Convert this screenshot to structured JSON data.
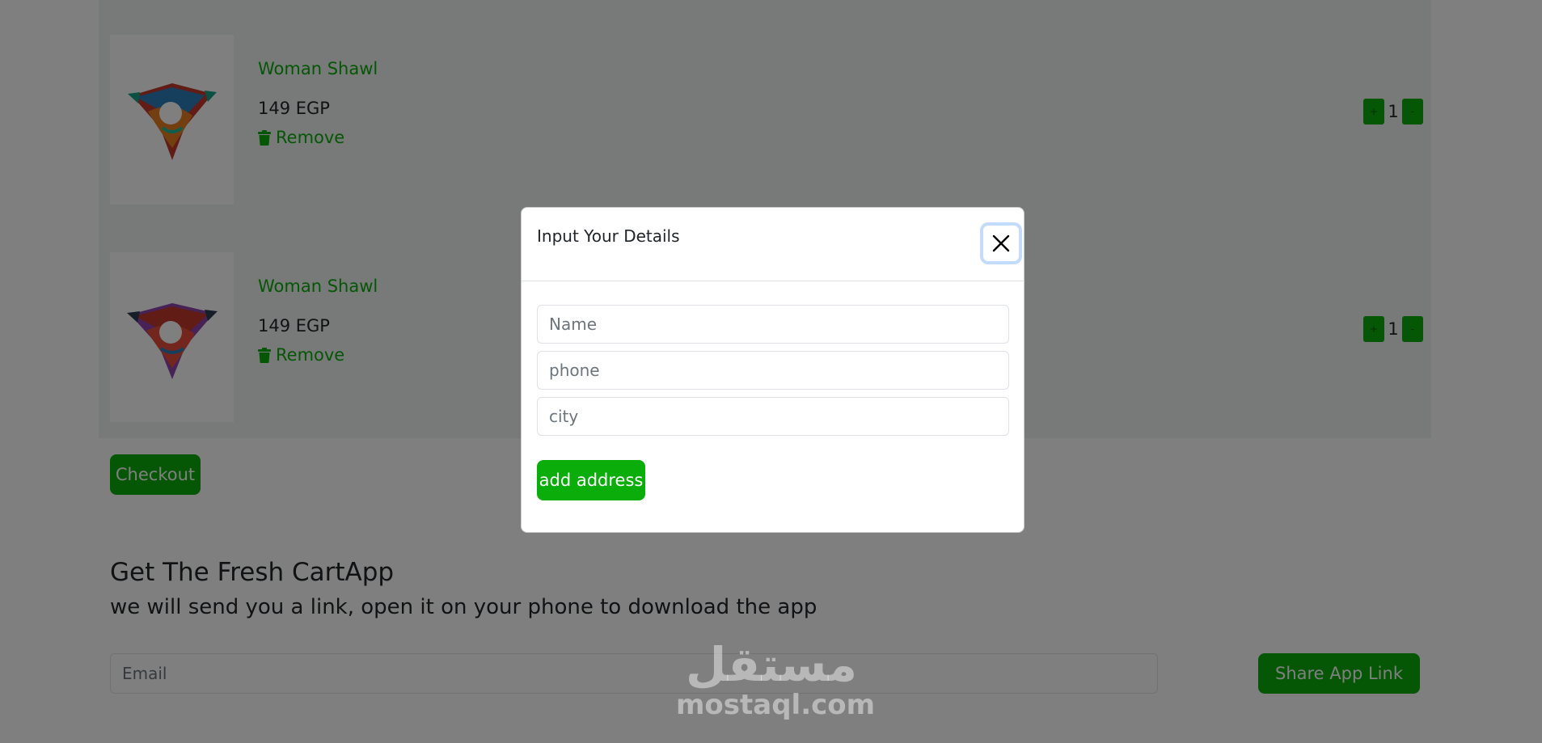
{
  "cart": {
    "items": [
      {
        "title": "Woman Shawl",
        "price": "149 EGP",
        "remove_label": "Remove",
        "quantity": "1",
        "plus_label": "+",
        "minus_label": "-"
      },
      {
        "title": "Woman Shawl",
        "price": "149 EGP",
        "remove_label": "Remove",
        "quantity": "1",
        "plus_label": "+",
        "minus_label": "-"
      }
    ],
    "checkout_label": "Checkout"
  },
  "app_promo": {
    "title": "Get The Fresh CartApp",
    "subtitle": "we will send you a link, open it on your phone to download the app",
    "email_placeholder": "Email",
    "share_label": "Share App Link"
  },
  "modal": {
    "title": "Input Your Details",
    "name_placeholder": "Name",
    "phone_placeholder": "phone",
    "city_placeholder": "city",
    "submit_label": "add address"
  },
  "watermark": {
    "arabic": "مستقل",
    "latin": "mostaql.com"
  },
  "colors": {
    "brand": "#0aad0a",
    "cart_background": "#f0f3f2"
  },
  "icons": {
    "remove": "trash-icon",
    "close": "close-icon"
  }
}
